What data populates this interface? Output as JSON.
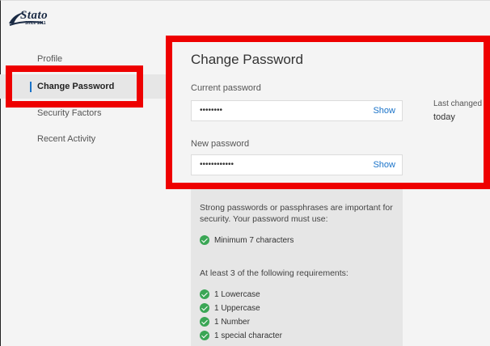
{
  "brand": {
    "logo_text": "Stato",
    "since_text": "Since 1911"
  },
  "sidebar": {
    "items": [
      {
        "label": "Profile"
      },
      {
        "label": "Change Password"
      },
      {
        "label": "Security Factors"
      },
      {
        "label": "Recent Activity"
      }
    ],
    "active_index": 1
  },
  "main": {
    "title": "Change Password",
    "current_password": {
      "label": "Current password",
      "value": "••••••••",
      "show_label": "Show"
    },
    "new_password": {
      "label": "New password",
      "value": "••••••••••••",
      "show_label": "Show"
    },
    "last_changed": {
      "label": "Last changed",
      "value": "today"
    },
    "requirements": {
      "intro": "Strong passwords or passphrases are important for security. Your password must use:",
      "minimum": "Minimum 7 characters",
      "subheading": "At least 3 of the following requirements:",
      "items": [
        "1 Lowercase",
        "1 Uppercase",
        "1 Number",
        "1 special character"
      ]
    }
  },
  "colors": {
    "accent": "#1a73c9",
    "check": "#3aa655",
    "highlight": "#ee0000"
  }
}
